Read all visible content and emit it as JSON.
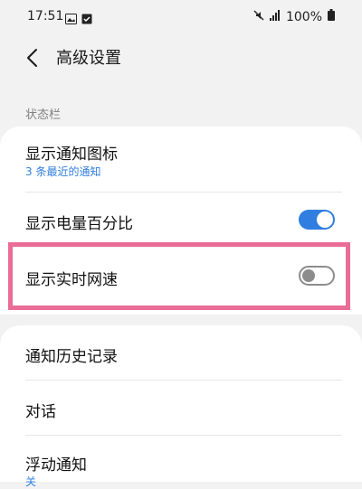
{
  "status_bar": {
    "time": "17:51",
    "battery": "100%",
    "icons": [
      "image-icon",
      "checkbox-icon",
      "mute-icon",
      "signal-icon",
      "battery-icon"
    ]
  },
  "header": {
    "back_icon": "chevron-left-icon",
    "title": "高级设置"
  },
  "section": {
    "label": "状态栏"
  },
  "rows": [
    {
      "title": "显示通知图标",
      "subtitle": "3 条最近的通知"
    },
    {
      "title": "显示电量百分比",
      "toggle": "on"
    },
    {
      "title": "显示实时网速",
      "toggle": "off"
    },
    {
      "title": "通知历史记录"
    },
    {
      "title": "对话"
    },
    {
      "title": "浮动通知",
      "subtitle": "关"
    }
  ],
  "colors": {
    "accent": "#2f7ee0",
    "highlight": "#e96d97",
    "background": "#f2f2f2"
  }
}
